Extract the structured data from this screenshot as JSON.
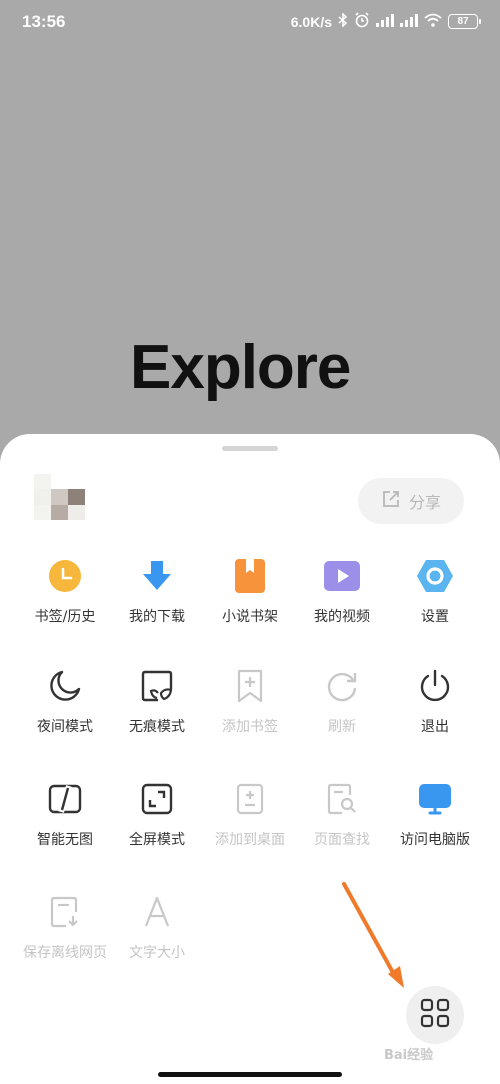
{
  "status": {
    "time": "13:56",
    "speed": "6.0K/s",
    "battery": "87"
  },
  "banner": {
    "logo_text": "Explore"
  },
  "share": {
    "label": "分享"
  },
  "menu": [
    {
      "label": "书签/历史",
      "icon": "bookmark-history-icon"
    },
    {
      "label": "我的下载",
      "icon": "download-icon"
    },
    {
      "label": "小说书架",
      "icon": "bookshelf-icon"
    },
    {
      "label": "我的视频",
      "icon": "video-icon"
    },
    {
      "label": "设置",
      "icon": "settings-icon"
    },
    {
      "label": "夜间模式",
      "icon": "moon-icon"
    },
    {
      "label": "无痕模式",
      "icon": "incognito-icon"
    },
    {
      "label": "添加书签",
      "icon": "add-bookmark-icon"
    },
    {
      "label": "刷新",
      "icon": "refresh-icon"
    },
    {
      "label": "退出",
      "icon": "power-icon"
    },
    {
      "label": "智能无图",
      "icon": "no-image-icon"
    },
    {
      "label": "全屏模式",
      "icon": "fullscreen-icon"
    },
    {
      "label": "添加到桌面",
      "icon": "add-to-desktop-icon"
    },
    {
      "label": "页面查找",
      "icon": "find-in-page-icon"
    },
    {
      "label": "访问电脑版",
      "icon": "desktop-version-icon"
    },
    {
      "label": "保存离线网页",
      "icon": "save-offline-icon"
    },
    {
      "label": "文字大小",
      "icon": "text-size-icon"
    }
  ],
  "watermark": "Bai经验",
  "colors": {
    "accent_blue": "#3a97f0",
    "accent_orange": "#f7933a",
    "accent_yellow": "#f6b73c",
    "accent_purple": "#9b8fea",
    "disabled": "#c4c4c4",
    "arrow": "#f07a2a"
  }
}
